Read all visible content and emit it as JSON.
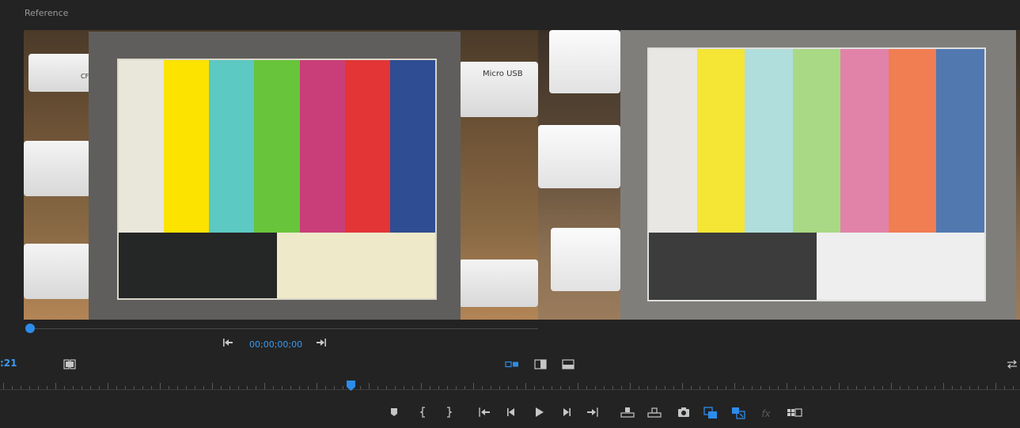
{
  "panel": {
    "title": "Reference"
  },
  "reference_view": {
    "bar_colors": [
      "#e9e6da",
      "#fde300",
      "#5cc9c2",
      "#68c43b",
      "#c93e78",
      "#e33535",
      "#2f4d92"
    ],
    "shelf_labels": [
      "CF",
      "Micro USB"
    ]
  },
  "program_view": {
    "bar_colors": [
      "#e8e7e3",
      "#f5e636",
      "#b0dedc",
      "#a9d984",
      "#e183a9",
      "#f17d52",
      "#5179b0"
    ]
  },
  "reference_controls": {
    "timecode": "00;00;00;00",
    "go_to_in_icon": "go-to-in-icon",
    "go_to_out_icon": "go-to-out-icon"
  },
  "left_timecode": ":21",
  "accent_color": "#2d8ceb",
  "transport": {
    "icons": [
      "marker-icon",
      "mark-in-icon",
      "mark-out-icon",
      "go-to-in-icon",
      "step-back-icon",
      "play-icon",
      "step-forward-icon",
      "go-to-out-icon",
      "insert-icon",
      "overlay-icon",
      "export-frame-icon",
      "comparison-view-icon",
      "toggle-proxies-icon",
      "fx-icon",
      "button-editor-icon"
    ],
    "fx_label": "fx"
  }
}
